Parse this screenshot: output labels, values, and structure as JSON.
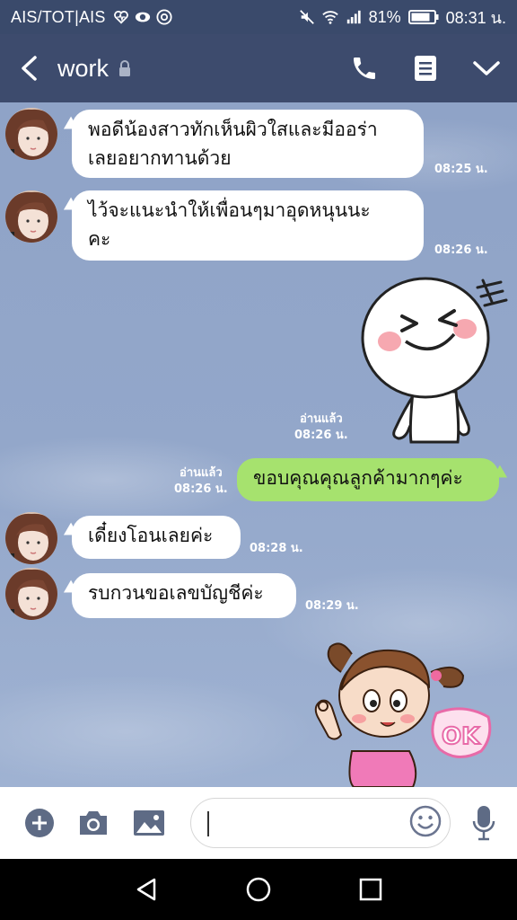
{
  "status_bar": {
    "carrier": "AIS/TOT|AIS",
    "battery": "81%",
    "time": "08:31 น."
  },
  "header": {
    "title": "work"
  },
  "messages": [
    {
      "side": "in",
      "text_line1": "พอดีน้องสาวทักเห็นผิวใสและมีออร่า",
      "text_line2": "เลยอยากทานด้วย",
      "time": "08:25 น."
    },
    {
      "side": "in",
      "text_line1": "ไว้จะแนะนำให้เพื่อนๆมาอุดหนุนนะ",
      "text_line2": "คะ",
      "time": "08:26 น."
    },
    {
      "side": "out",
      "type": "sticker",
      "sticker": "moon-laughing-sticker",
      "read": "อ่านแล้ว",
      "time": "08:26 น."
    },
    {
      "side": "out",
      "text_line1": "ขอบคุณคุณลูกค้ามากๆค่ะ",
      "read": "อ่านแล้ว",
      "time": "08:26 น."
    },
    {
      "side": "in",
      "text_line1": "เดี๋ยงโอนเลยค่ะ",
      "time": "08:28 น."
    },
    {
      "side": "in",
      "text_line1": "รบกวนขอเลขบัญชีค่ะ",
      "time": "08:29 น."
    },
    {
      "side": "in",
      "type": "sticker",
      "sticker": "girl-ok-sticker",
      "sticker_text": "OK"
    }
  ],
  "input": {
    "placeholder": ""
  },
  "colors": {
    "header_bg": "#3d4b6d",
    "status_bg": "#3a4a6b",
    "chat_bg": "#93a7ca",
    "outgoing_bubble": "#a6e26e",
    "incoming_bubble": "#ffffff"
  }
}
